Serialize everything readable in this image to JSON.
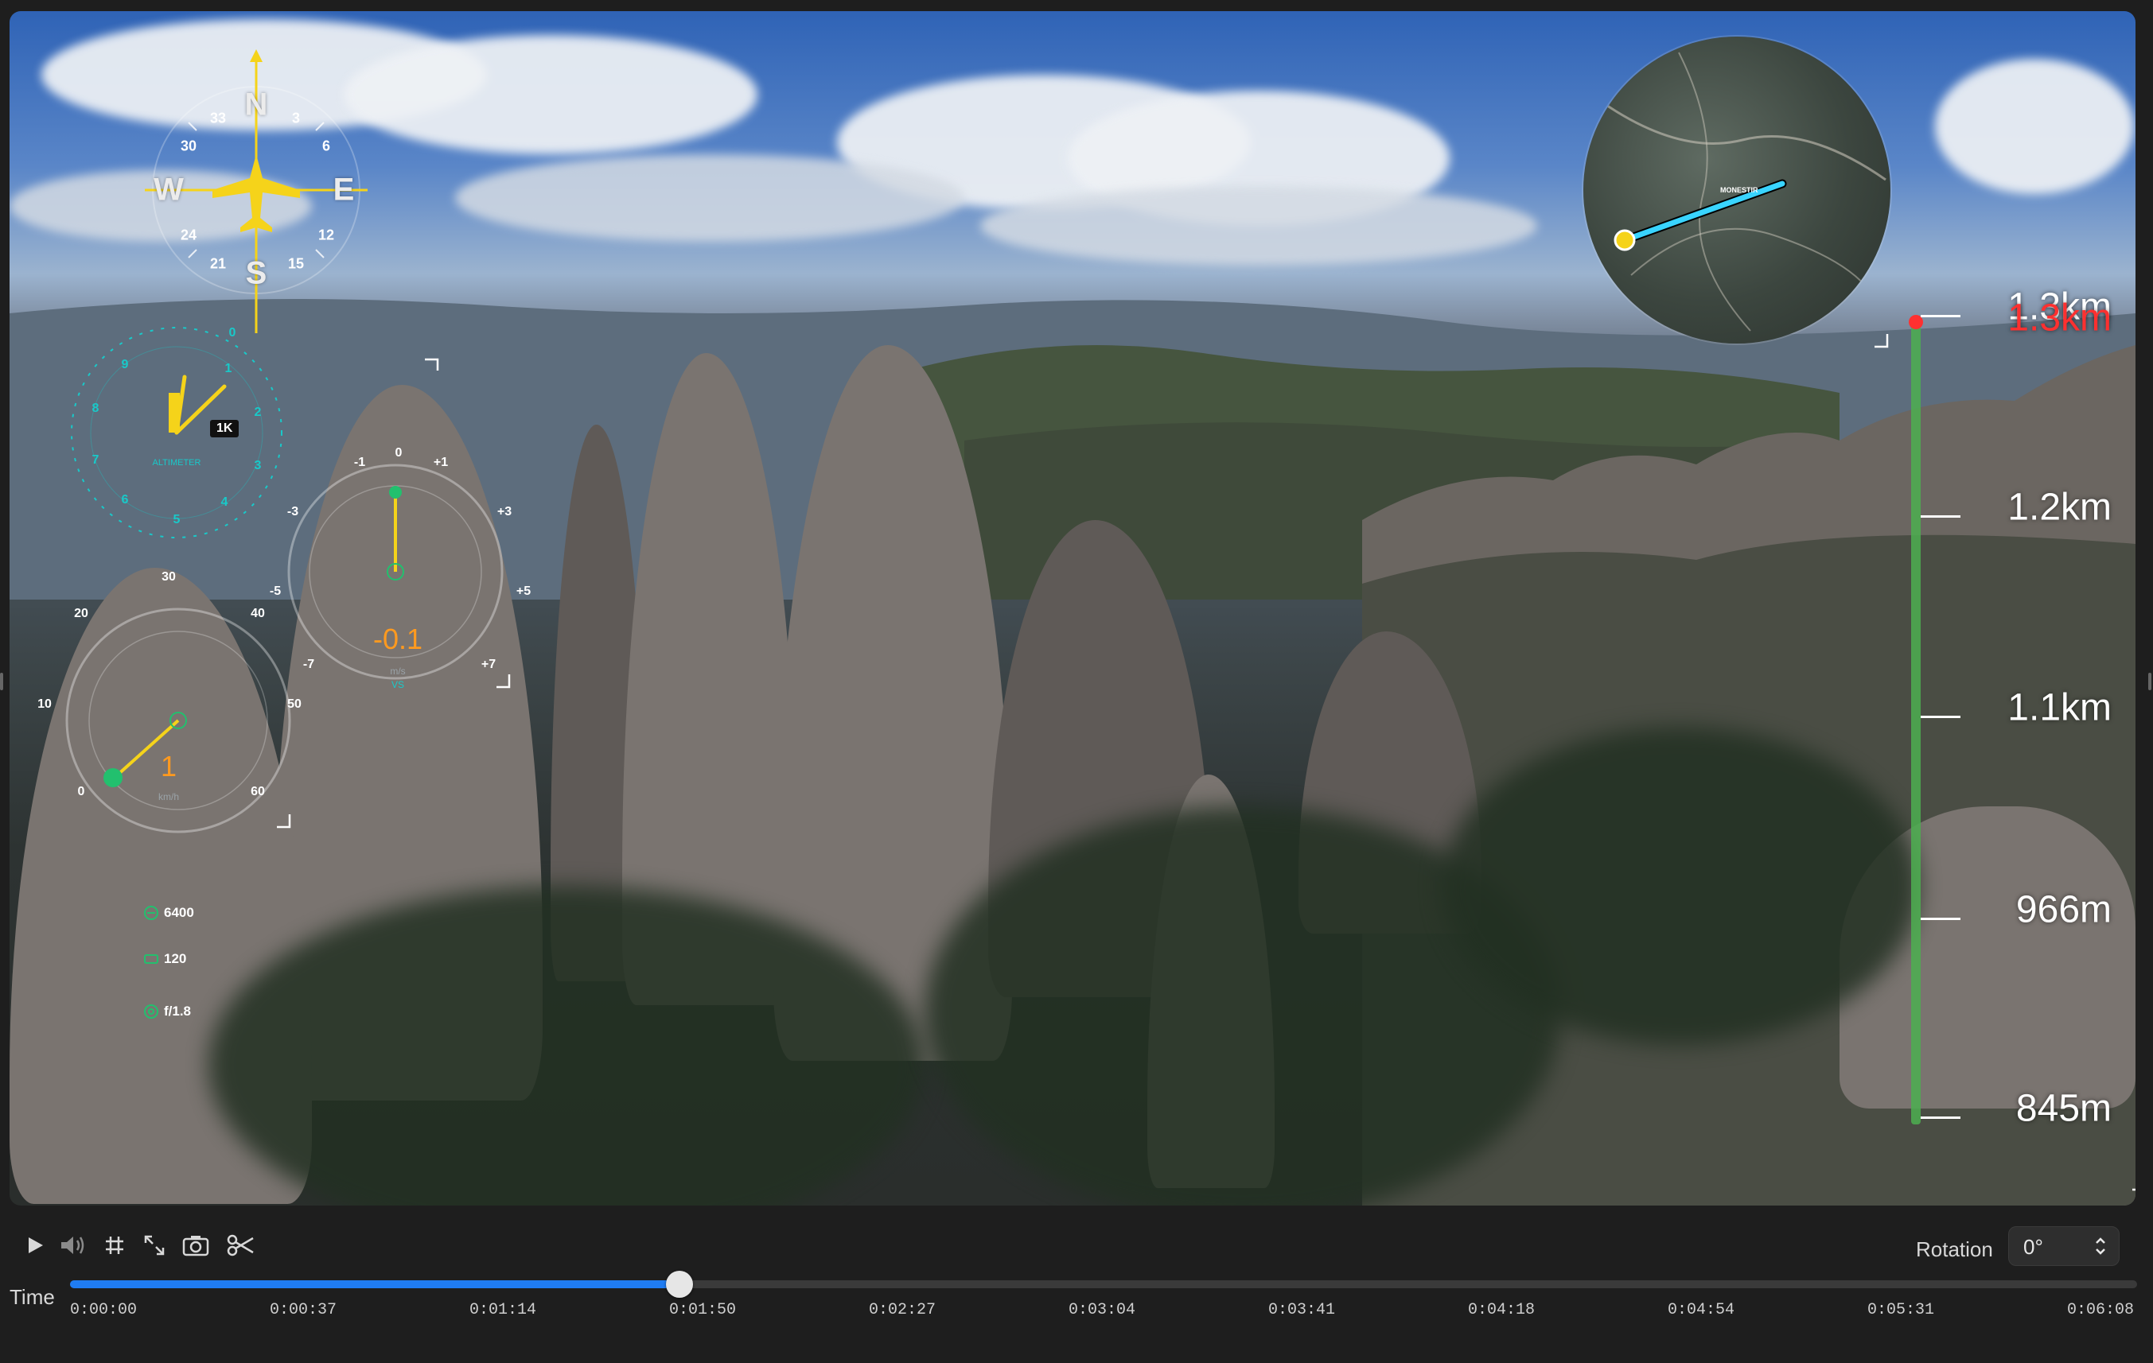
{
  "hud": {
    "compass": {
      "heading_deg": 0,
      "labels": {
        "north": "N",
        "east": "E",
        "south": "S",
        "west": "W"
      },
      "tick_numbers": [
        "3",
        "6",
        "12",
        "15",
        "21",
        "24",
        "30",
        "33"
      ],
      "color": "#f5d31a"
    },
    "altimeter": {
      "badge": "1K",
      "caption": "ALTIMETER",
      "accent": "#19c9c9",
      "dial_numbers": [
        "0",
        "1",
        "2",
        "3",
        "4",
        "5",
        "6",
        "7",
        "8",
        "9"
      ]
    },
    "vertical_speed": {
      "value": "-0.1",
      "unit": "m/s",
      "caption": "VS",
      "ticks": [
        "-1",
        "0",
        "+1",
        "+3",
        "+5",
        "+7",
        "-3",
        "-5",
        "-7"
      ]
    },
    "speed": {
      "value": "1",
      "unit": "km/h",
      "ticks": [
        "0",
        "10",
        "20",
        "30",
        "40",
        "50",
        "60"
      ]
    },
    "camera": {
      "iso": "6400",
      "shutter": "120",
      "aperture": "f/1.8"
    },
    "altitude_scale": {
      "labels": [
        "1.3km",
        "1.2km",
        "1.1km",
        "966m",
        "845m"
      ],
      "current": "1.3km",
      "bar_color": "#4caf50",
      "current_color": "#ff3030"
    },
    "minimap": {
      "place_label": "MONESTIR",
      "route_color": "#39d4ff"
    }
  },
  "controls": {
    "buttons": [
      "play-icon",
      "volume-icon",
      "grid-icon",
      "fullscreen-icon",
      "camera-icon",
      "scissors-icon"
    ],
    "rotation_label": "Rotation",
    "rotation_value": "0°",
    "time_label": "Time",
    "progress_fraction": 0.295,
    "timeline_ticks": [
      "0:00:00",
      "0:00:37",
      "0:01:14",
      "0:01:50",
      "0:02:27",
      "0:03:04",
      "0:03:41",
      "0:04:18",
      "0:04:54",
      "0:05:31",
      "0:06:08"
    ],
    "accent": "#1f7cf2"
  }
}
